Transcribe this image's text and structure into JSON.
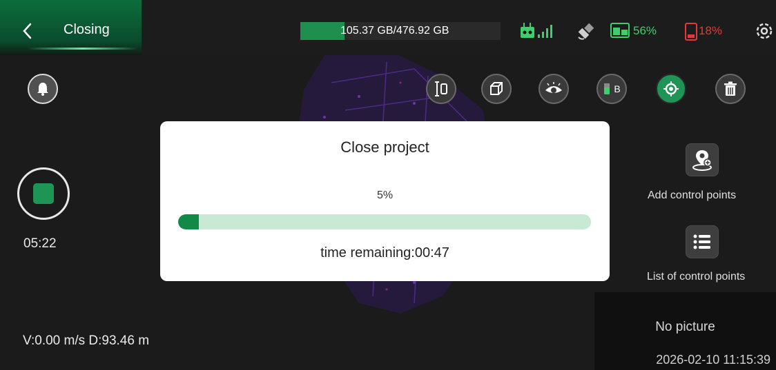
{
  "header": {
    "title": "Closing",
    "storage": {
      "text": "105.37 GB/476.92 GB",
      "used_fraction": 0.221
    },
    "controller_battery": "56%",
    "drone_battery": "18%"
  },
  "toolbar": {
    "buttons": [
      {
        "name": "height-tool-button",
        "icon": "height-ruler-icon",
        "active": false
      },
      {
        "name": "3d-view-button",
        "icon": "cube-icon",
        "active": false
      },
      {
        "name": "visibility-button",
        "icon": "eye-icon",
        "active": false
      },
      {
        "name": "b-mode-button",
        "icon": "battery-b-icon",
        "label": "B",
        "active": false
      },
      {
        "name": "locate-button",
        "icon": "target-icon",
        "active": true
      },
      {
        "name": "delete-button",
        "icon": "trash-icon",
        "active": false
      }
    ]
  },
  "record": {
    "time": "05:22"
  },
  "telemetry": {
    "speed_distance": "V:0.00 m/s  D:93.46 m"
  },
  "side_tools": {
    "add_control_points": "Add control points",
    "list_control_points": "List of control points"
  },
  "picture_panel": {
    "no_picture": "No picture",
    "datetime": "2026-02-10 11:15:39"
  },
  "dialog": {
    "title": "Close project",
    "percent_text": "5%",
    "progress": 0.05,
    "remaining": "time remaining:00:47"
  },
  "colors": {
    "accent": "#1e9455",
    "battery_ok": "#2ecc71",
    "battery_low": "#e03a3a",
    "progress_track": "#c8e9d4"
  }
}
